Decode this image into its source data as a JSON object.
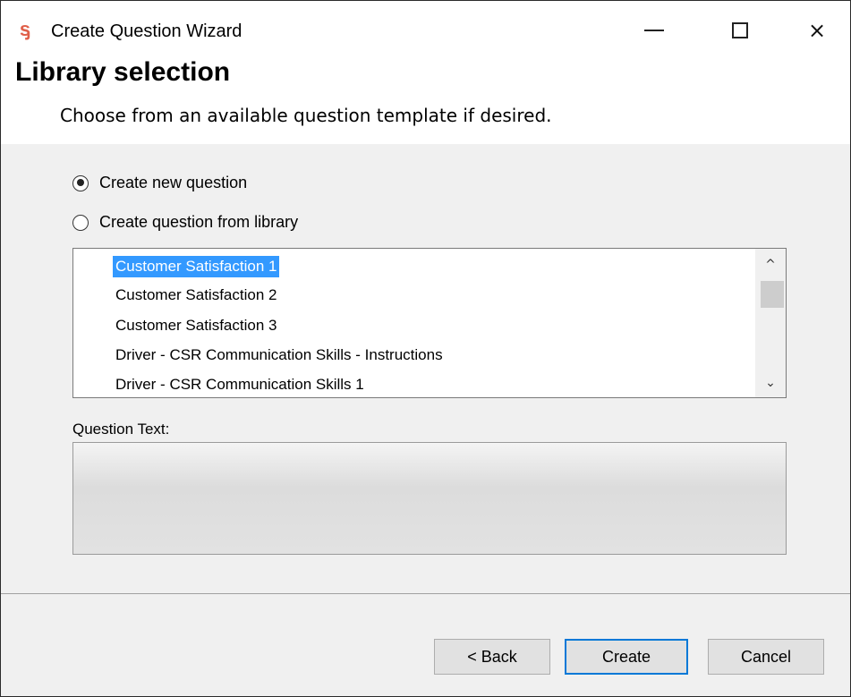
{
  "window": {
    "title": "Create Question Wizard",
    "icon": "app-logo-icon",
    "controls": {
      "minimize": "minimize-icon",
      "maximize": "maximize-icon",
      "close": "×"
    }
  },
  "header": {
    "title": "Library selection",
    "subtitle": "Choose from an available question template if desired."
  },
  "options": {
    "create_new": {
      "label": "Create new question",
      "selected": true
    },
    "create_from_library": {
      "label": "Create question from library",
      "selected": false
    }
  },
  "library": {
    "items": [
      "Customer Satisfaction 1",
      "Customer Satisfaction 2",
      "Customer Satisfaction 3",
      "Driver - CSR Communication Skills - Instructions",
      "Driver - CSR Communication Skills 1"
    ],
    "selected_index": 0,
    "scroll_up": "^",
    "scroll_down": "⌄"
  },
  "question_text": {
    "label": "Question Text:",
    "value": ""
  },
  "buttons": {
    "back": "< Back",
    "create": "Create",
    "cancel": "Cancel"
  },
  "colors": {
    "selection": "#3399ff",
    "default_button_border": "#0078d7",
    "app_icon": "#e0604a"
  }
}
